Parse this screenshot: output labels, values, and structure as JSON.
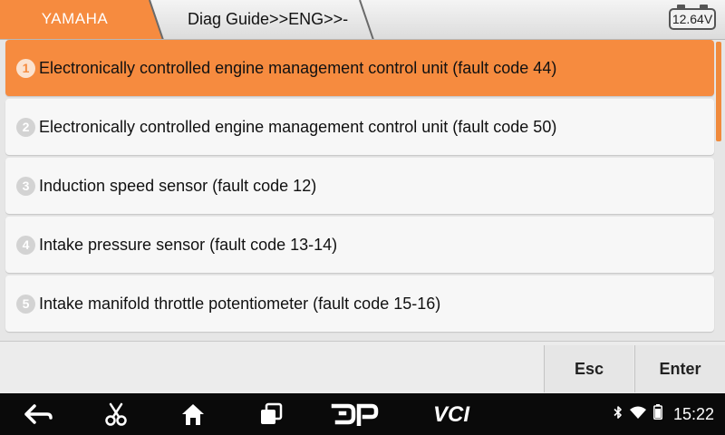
{
  "header": {
    "brand": "YAMAHA",
    "path": "Diag Guide>>ENG>>-",
    "voltage": "12.64V",
    "brand_color": "#f68b3f"
  },
  "list": {
    "selected_index": 0,
    "items": [
      {
        "number": "1",
        "label": "Electronically controlled engine management control unit (fault code 44)"
      },
      {
        "number": "2",
        "label": "Electronically controlled engine management control unit (fault code 50)"
      },
      {
        "number": "3",
        "label": "Induction speed sensor (fault code 12)"
      },
      {
        "number": "4",
        "label": "Intake pressure sensor (fault code 13-14)"
      },
      {
        "number": "5",
        "label": "Intake manifold throttle potentiometer (fault code 15-16)"
      }
    ]
  },
  "actions": {
    "esc_label": "Esc",
    "enter_label": "Enter"
  },
  "navbar": {
    "icons": [
      "back-icon",
      "scissors-icon",
      "home-icon",
      "recent-apps-icon",
      "dp-icon",
      "vci-icon"
    ],
    "dp_label": "DP",
    "vci_label": "VCI"
  },
  "status": {
    "icons": [
      "bluetooth-icon",
      "wifi-icon",
      "battery-icon"
    ],
    "time": "15:22"
  }
}
